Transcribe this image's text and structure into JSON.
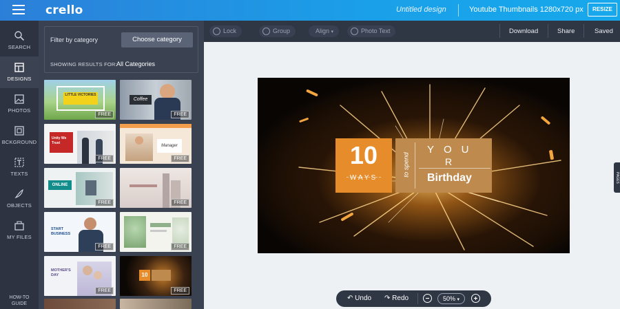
{
  "app": {
    "logo": "crello",
    "doc_title": "Untitled design",
    "format": "Youtube Thumbnails 1280x720 px",
    "resize_label": "RESIZE"
  },
  "rail": {
    "items": [
      {
        "label": "SEARCH",
        "icon": "search-icon"
      },
      {
        "label": "DESIGNS",
        "icon": "designs-icon",
        "active": true
      },
      {
        "label": "PHOTOS",
        "icon": "photos-icon"
      },
      {
        "label": "BCKGROUND",
        "icon": "background-icon"
      },
      {
        "label": "TEXTS",
        "icon": "texts-icon"
      },
      {
        "label": "OBJECTS",
        "icon": "objects-icon"
      },
      {
        "label": "MY FILES",
        "icon": "my-files-icon"
      }
    ],
    "howto_line1": "HOW-TO",
    "howto_line2": "GUIDE"
  },
  "panel": {
    "filter_label": "Filter by category",
    "choose_label": "Choose category",
    "results_label": "SHOWING RESULTS FOR:",
    "results_value": "All Categories",
    "free_label": "FREE",
    "thumbs": [
      {
        "title": "LITTLE VICTORIES"
      },
      {
        "title": "Coffee"
      },
      {
        "title": "Unity We Trust"
      },
      {
        "title": "Manager"
      },
      {
        "title": "ONLINE"
      },
      {
        "title": ""
      },
      {
        "title": "START BUSINESS"
      },
      {
        "title": ""
      },
      {
        "title": "MOTHER'S DAY"
      },
      {
        "title": "10"
      }
    ]
  },
  "toolbar": {
    "lock": "Lock",
    "group": "Group",
    "align": "Align",
    "photo_text": "Photo Text",
    "download": "Download",
    "share": "Share",
    "saved": "Saved"
  },
  "artboard": {
    "number": "10",
    "ways": "WAYS",
    "to_spend": "to spend",
    "your": "YOU",
    "r": "R",
    "birthday": "Birthday"
  },
  "side_tab": "PAGES",
  "bottom": {
    "undo": "Undo",
    "redo": "Redo",
    "zoom": "50%"
  },
  "colors": {
    "topbar": "#2c7fd8",
    "accent_orange": "#e78c2a",
    "accent_gold": "#be8a4d"
  }
}
